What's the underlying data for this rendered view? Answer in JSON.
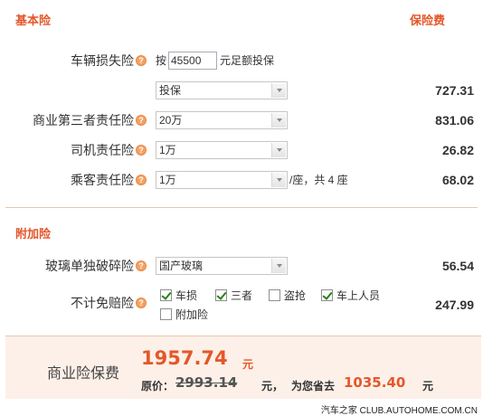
{
  "sections": {
    "basic_title": "基本险",
    "premium_header": "保险费",
    "addon_title": "附加险"
  },
  "help_glyph": "?",
  "vehicle_loss": {
    "label": "车辆损失险",
    "prefix": "按",
    "insured_value": "45500",
    "suffix": "元足额投保",
    "option": "投保",
    "price": "727.31"
  },
  "third_party": {
    "label": "商业第三者责任险",
    "option": "20万",
    "price": "831.06"
  },
  "driver": {
    "label": "司机责任险",
    "option": "1万",
    "price": "26.82"
  },
  "passenger": {
    "label": "乘客责任险",
    "option": "1万",
    "note": "/座，共 4 座",
    "price": "68.02"
  },
  "glass": {
    "label": "玻璃单独破碎险",
    "option": "国产玻璃",
    "price": "56.54"
  },
  "deductible": {
    "label": "不计免赔险",
    "price": "247.99",
    "options": [
      {
        "label": "车损",
        "checked": true
      },
      {
        "label": "三者",
        "checked": true
      },
      {
        "label": "盗抢",
        "checked": false
      },
      {
        "label": "车上人员",
        "checked": true
      },
      {
        "label": "附加险",
        "checked": false
      }
    ]
  },
  "summary": {
    "label": "商业险保费",
    "total": "1957.74",
    "unit": "元",
    "original_label": "原价：",
    "original": "2993.14",
    "original_unit": "元，",
    "save_label": "为您省去",
    "save": "1035.40",
    "save_unit": "元"
  },
  "watermark": "汽车之家 CLUB.AUTOHOME.COM.CN",
  "colors": {
    "accent": "#e4572a",
    "summary_bg": "#fdf0e8",
    "help": "#f4a161",
    "check": "#2a7d1a"
  }
}
